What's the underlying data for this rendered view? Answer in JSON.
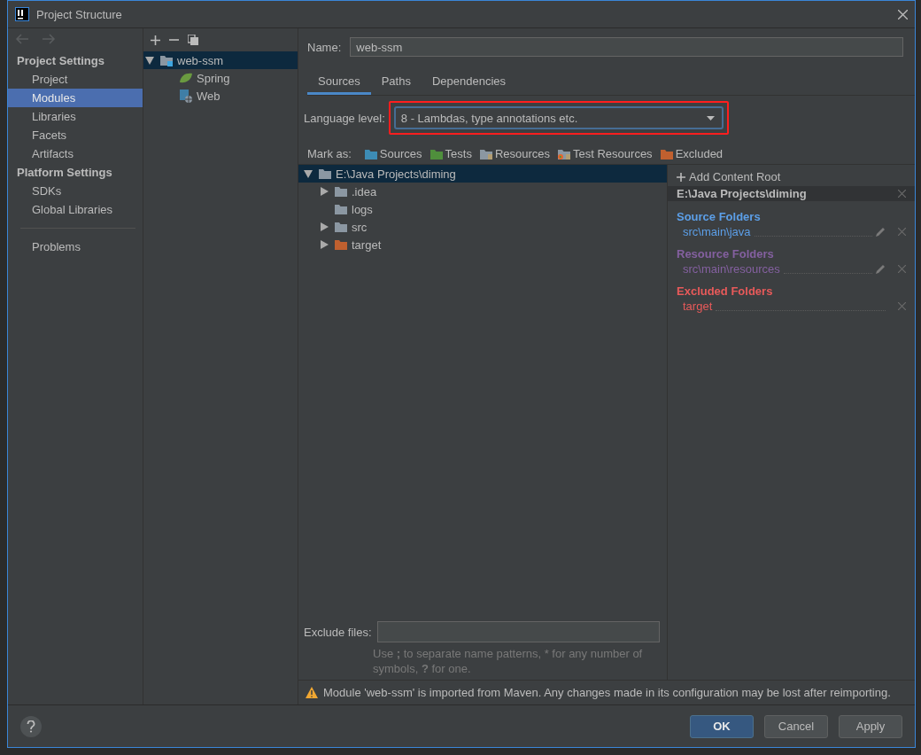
{
  "window": {
    "title": "Project Structure"
  },
  "sidebar": {
    "sections": [
      {
        "header": "Project Settings",
        "items": [
          {
            "label": "Project",
            "selected": false
          },
          {
            "label": "Modules",
            "selected": true
          },
          {
            "label": "Libraries",
            "selected": false
          },
          {
            "label": "Facets",
            "selected": false
          },
          {
            "label": "Artifacts",
            "selected": false
          }
        ]
      },
      {
        "header": "Platform Settings",
        "items": [
          {
            "label": "SDKs",
            "selected": false
          },
          {
            "label": "Global Libraries",
            "selected": false
          }
        ]
      }
    ],
    "footer_items": [
      {
        "label": "Problems",
        "selected": false
      }
    ]
  },
  "modules": {
    "tree": [
      {
        "label": "web-ssm",
        "kind": "module",
        "expanded": true,
        "selected": true,
        "children": [
          {
            "label": "Spring",
            "kind": "spring",
            "selected": false
          },
          {
            "label": "Web",
            "kind": "web",
            "selected": false
          }
        ]
      }
    ]
  },
  "name": {
    "label": "Name:",
    "value": "web-ssm"
  },
  "tabs": [
    {
      "label": "Sources",
      "selected": true
    },
    {
      "label": "Paths",
      "selected": false
    },
    {
      "label": "Dependencies",
      "selected": false
    }
  ],
  "language_level": {
    "label": "Language level:",
    "value": "8 - Lambdas, type annotations etc.",
    "highlighted": true
  },
  "mark_as": {
    "label": "Mark as:",
    "items": [
      {
        "label": "Sources",
        "kind": "sources"
      },
      {
        "label": "Tests",
        "kind": "tests"
      },
      {
        "label": "Resources",
        "kind": "resources"
      },
      {
        "label": "Test Resources",
        "kind": "test-resources"
      },
      {
        "label": "Excluded",
        "kind": "excluded"
      }
    ]
  },
  "folders": [
    {
      "label": "E:\\Java Projects\\diming",
      "kind": "plain",
      "expanded": true,
      "selected": true,
      "children": [
        {
          "label": ".idea",
          "kind": "plain",
          "expanded": false,
          "selected": false
        },
        {
          "label": "logs",
          "kind": "plain",
          "selected": false
        },
        {
          "label": "src",
          "kind": "plain",
          "expanded": false,
          "selected": false
        },
        {
          "label": "target",
          "kind": "excluded",
          "expanded": false,
          "selected": false
        }
      ]
    }
  ],
  "exclude_files": {
    "label": "Exclude files:",
    "hint": "Use **;** to separate name patterns, * for any number of symbols, **?** for one."
  },
  "content_root": {
    "add": "Add Content Root",
    "path": "E:\\Java Projects\\diming",
    "groups": [
      {
        "title": "Source Folders",
        "color": "#5c9fe8",
        "entries": [
          {
            "path": "src\\main\\java",
            "editable": true
          }
        ]
      },
      {
        "title": "Resource Folders",
        "color": "#8460a0",
        "entries": [
          {
            "path": "src\\main\\resources",
            "editable": true
          }
        ]
      },
      {
        "title": "Excluded Folders",
        "color": "#e85a5a",
        "entries": [
          {
            "path": "target",
            "editable": false
          }
        ]
      }
    ]
  },
  "warning": "Module 'web-ssm' is imported from Maven. Any changes made in its configuration may be lost after reimporting.",
  "buttons": [
    {
      "label": "OK",
      "default": true
    },
    {
      "label": "Cancel",
      "default": false
    },
    {
      "label": "Apply",
      "default": false
    }
  ]
}
